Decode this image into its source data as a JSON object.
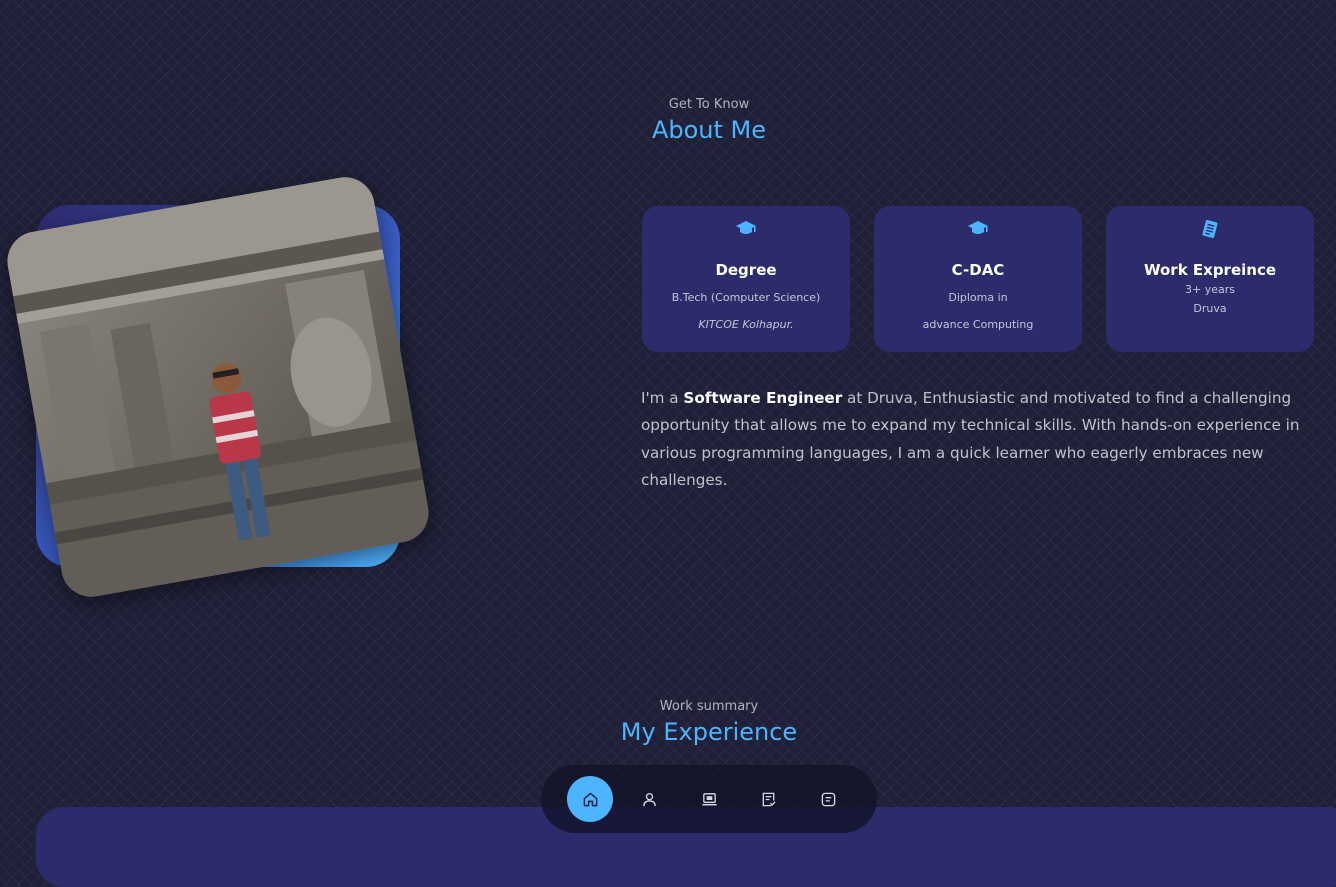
{
  "about": {
    "subtitle": "Get To Know",
    "title": "About Me"
  },
  "cards": [
    {
      "icon": "graduation-cap-icon",
      "title": "Degree",
      "line1": "B.Tech (Computer Science)",
      "line2": "KITCOE Kolhapur."
    },
    {
      "icon": "graduation-cap-icon",
      "title": "C-DAC",
      "line1": "Diploma in",
      "line2": "advance Computing"
    },
    {
      "icon": "clipboard-icon",
      "title": "Work Expreince",
      "line1": "3+ years",
      "line2": "Druva"
    }
  ],
  "bio": {
    "lead": "I'm a ",
    "role": "Software Engineer",
    "rest": " at Druva, Enthusiastic and motivated to find a challenging opportunity that allows me to expand my technical skills. With hands-on experience in various programming languages, I am a quick learner who eagerly embraces new challenges."
  },
  "experience": {
    "subtitle": "Work summary",
    "title": "My Experience"
  },
  "nav": {
    "items": [
      "home-icon",
      "user-icon",
      "laptop-icon",
      "checklist-icon",
      "message-icon"
    ],
    "active": "home-icon"
  },
  "colors": {
    "background": "#1f1f38",
    "accent": "#4db5ff",
    "card": "#2c2c6c"
  }
}
